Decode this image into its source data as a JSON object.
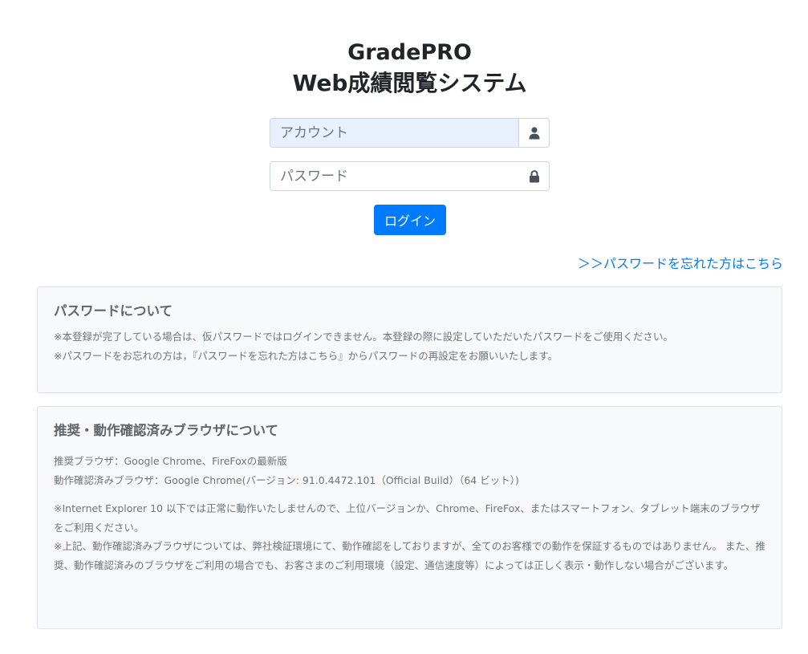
{
  "header": {
    "app_name": "GradePRO",
    "app_subtitle": "Web成績閲覧システム"
  },
  "login_form": {
    "account_placeholder": "アカウント",
    "account_icon": "user-icon",
    "password_placeholder": "パスワード",
    "password_icon": "lock-icon",
    "login_label": "ログイン",
    "forgot_link": "＞＞パスワードを忘れた方はこちら"
  },
  "password_notice": {
    "title": "パスワードについて",
    "lines": [
      "※本登録が完了している場合は、仮パスワードではログインできません。本登録の際に設定していただいたパスワードをご使用ください。",
      "※パスワードをお忘れの方は，『パスワードを忘れた方はこちら』からパスワードの再設定をお願いいたします。"
    ]
  },
  "browser_notice": {
    "title": "推奨・動作確認済みブラウザについて",
    "recommended": "推奨ブラウザ：Google Chrome、FireFoxの最新版",
    "verified": "動作確認済みブラウザ：Google Chrome(バージョン: 91.0.4472.101（Official Build）（64 ビット）)",
    "note1": "※Internet Explorer 10 以下では正常に動作いたしませんので、上位バージョンか、Chrome、FireFox、またはスマートフォン、タブレット端末のブラウザをご利用ください。",
    "note2": "※上記、動作確認済みブラウザについては、弊社検証環境にて、動作確認をしておりますが、全てのお客様での動作を保証するものではありません。 また、推奨、動作確認済みのブラウザをご利用の場合でも、お客さまのご利用環境（設定、通信速度等）によっては正しく表示・動作しない場合がございます。"
  },
  "colors": {
    "primary": "#007bff",
    "card_bg": "#f8f9fa",
    "autofill_bg": "#e8f0fe"
  }
}
